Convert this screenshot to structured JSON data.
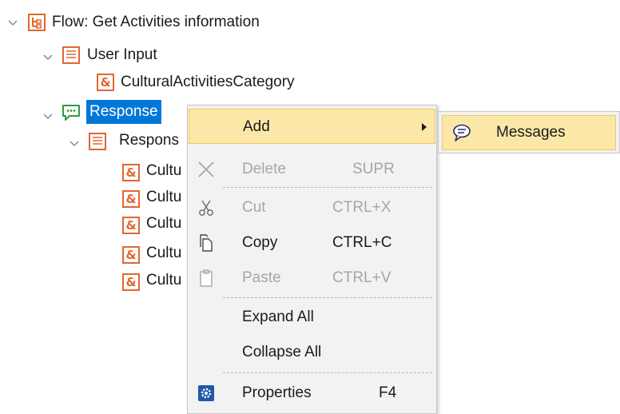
{
  "tree": {
    "flow_label": "Flow: Get Activities information",
    "user_input_label": "User Input",
    "category_label": "CulturalActivitiesCategory",
    "response_label": "Response",
    "response_child_label": "Respons",
    "cultural_items": [
      "Cultu",
      "Cultu",
      "Cultu",
      "Cultu",
      "Cultu"
    ]
  },
  "context_menu": {
    "add_label": "Add",
    "delete_label": "Delete",
    "delete_key": "SUPR",
    "cut_label": "Cut",
    "cut_key": "CTRL+X",
    "copy_label": "Copy",
    "copy_key": "CTRL+C",
    "paste_label": "Paste",
    "paste_key": "CTRL+V",
    "expand_all_label": "Expand All",
    "collapse_all_label": "Collapse All",
    "properties_label": "Properties",
    "properties_key": "F4"
  },
  "submenu": {
    "messages_label": "Messages"
  },
  "colors": {
    "accent_orange": "#e2662f",
    "selection_blue": "#0078d7",
    "highlight": "#fbe7a7",
    "response_green": "#2e9b3e"
  }
}
